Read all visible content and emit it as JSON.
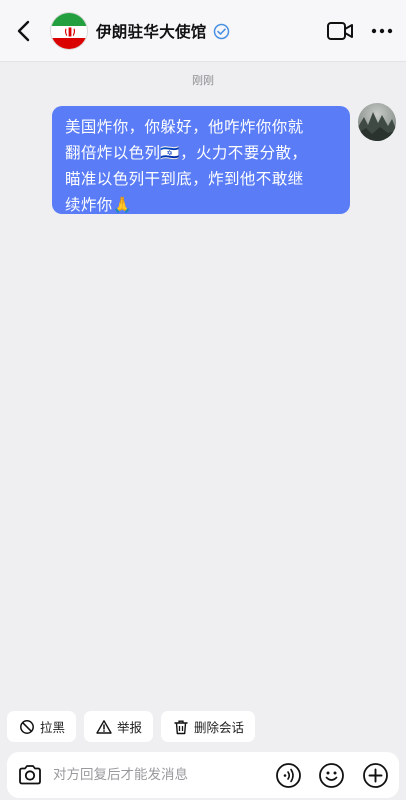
{
  "header": {
    "title": "伊朗驻华大使馆",
    "verified": true,
    "icons": [
      "back-icon",
      "iran-flag-avatar",
      "verified-icon",
      "video-call-icon",
      "more-icon"
    ]
  },
  "chat": {
    "time_label": "刚刚",
    "messages": [
      {
        "lines": [
          "美国炸你，你躲好，他咋炸你你就",
          "翻倍炸以色列🇮🇱，火力不要分散，",
          "瞄准以色列干到底，炸到他不敢继",
          "续炸你🙏"
        ]
      }
    ]
  },
  "quick_actions": [
    {
      "label": "拉黑",
      "icon": "block-icon"
    },
    {
      "label": "举报",
      "icon": "warning-icon"
    },
    {
      "label": "删除会话",
      "icon": "trash-icon"
    }
  ],
  "input": {
    "placeholder": "对方回复后才能发消息",
    "icons": [
      "camera-icon",
      "voice-icon",
      "emoji-icon",
      "plus-icon"
    ]
  },
  "colors": {
    "bubble": "#5a7cf6",
    "background": "#efeff1",
    "verified": "#4a90e2"
  }
}
